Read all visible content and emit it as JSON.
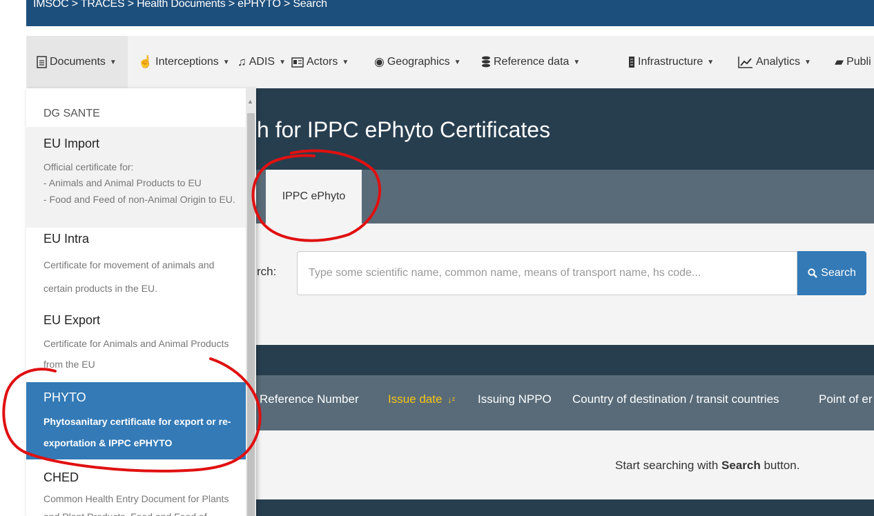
{
  "breadcrumb": "IMSOC > TRACES > Health Documents > ePHYTO > Search",
  "menu": [
    {
      "label": "Documents",
      "icon": "file-text-icon"
    },
    {
      "label": "Interceptions",
      "icon": "hand-icon"
    },
    {
      "label": "ADIS",
      "icon": "bell-icon"
    },
    {
      "label": "Actors",
      "icon": "id-card-icon"
    },
    {
      "label": "Geographics",
      "icon": "globe-icon"
    },
    {
      "label": "Reference data",
      "icon": "database-icon"
    },
    {
      "label": "Infrastructure",
      "icon": "server-icon"
    },
    {
      "label": "Analytics",
      "icon": "chart-line-icon"
    },
    {
      "label": "Publi",
      "icon": "book-icon"
    }
  ],
  "page_title": "h for IPPC ePhyto Certificates",
  "tab": "IPPC ePhyto",
  "search": {
    "label": "rch:",
    "placeholder": "Type some scientific name, common name, means of transport name, hs code...",
    "button": "Search"
  },
  "columns": [
    "Reference Number",
    "Issue date",
    "Issuing NPPO",
    "Country of destination / transit countries",
    "Point of er"
  ],
  "empty_message": {
    "prefix": "Start searching with ",
    "bold": "Search",
    "suffix": " button."
  },
  "dropdown": {
    "section": "DG SANTE",
    "items": [
      {
        "title": "EU Import",
        "desc": [
          "Official certificate for:",
          "- Animals and Animal Products to EU",
          "- Food and Feed of non-Animal Origin to EU."
        ]
      },
      {
        "title": "EU Intra",
        "desc": [
          "Certificate for movement of animals and",
          "certain products in the EU."
        ]
      },
      {
        "title": "EU Export",
        "desc": [
          "Certificate for Animals and Animal Products",
          "from the EU"
        ]
      },
      {
        "title": "PHYTO",
        "desc": [
          "Phytosanitary certificate for export or re-",
          "exportation & IPPC ePHYTO"
        ]
      },
      {
        "title": "CHED",
        "desc": [
          "Common Health Entry Document for Plants",
          "and Plant Products, Food and Feed of"
        ]
      }
    ]
  },
  "colors": {
    "breadcrumb_bg": "#1d4f7c",
    "header_bg": "#273e4f",
    "tabs_bg": "#596b78",
    "accent": "#337ab7",
    "sorted": "#f5c518",
    "annotation": "#e01010"
  }
}
